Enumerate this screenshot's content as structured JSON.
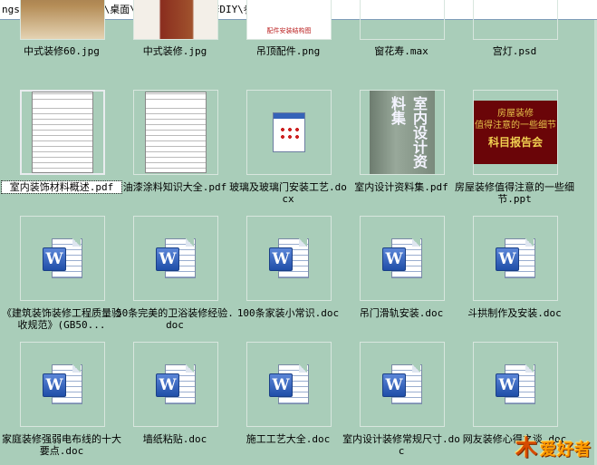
{
  "path": "ngs\\Administrator\\桌面\\装修家具DIY\\装修DIY\\参考",
  "top_row": [
    {
      "name": "中式装修60.jpg"
    },
    {
      "name": "中式装修.jpg"
    },
    {
      "name": "吊顶配件.png",
      "thumb_text": "配件安装结构图"
    },
    {
      "name": "窗花寿.max"
    },
    {
      "name": "宫灯.psd"
    }
  ],
  "row2": [
    {
      "name": "室内装饰材料概述.pdf",
      "selected": true
    },
    {
      "name": "油漆涂料知识大全.pdf"
    },
    {
      "name": "玻璃及玻璃门安装工艺.docx"
    },
    {
      "name": "室内设计资料集.pdf",
      "thumb_text": "室内设计资料集"
    },
    {
      "name": "房屋装修值得注意的一些细节.ppt",
      "thumb_line1": "房屋装修",
      "thumb_line2": "值得注意的一些细节",
      "thumb_big": "科目报告会"
    }
  ],
  "row3": [
    {
      "name": "《建筑装饰装修工程质量验收规范》(GB50..."
    },
    {
      "name": "50条完美的卫浴装修经验.doc"
    },
    {
      "name": "100条家装小常识.doc"
    },
    {
      "name": "吊门滑轨安装.doc"
    },
    {
      "name": "斗拱制作及安装.doc"
    }
  ],
  "row4": [
    {
      "name": "家庭装修强弱电布线的十大要点.doc"
    },
    {
      "name": "墙纸粘贴.doc"
    },
    {
      "name": "施工工艺大全.doc"
    },
    {
      "name": "室内设计装修常规尺寸.doc"
    },
    {
      "name": "网友装修心得之谈.doc"
    }
  ],
  "icons": {
    "word": "W"
  },
  "watermark": {
    "mark": "木",
    "text": "爱好者"
  }
}
